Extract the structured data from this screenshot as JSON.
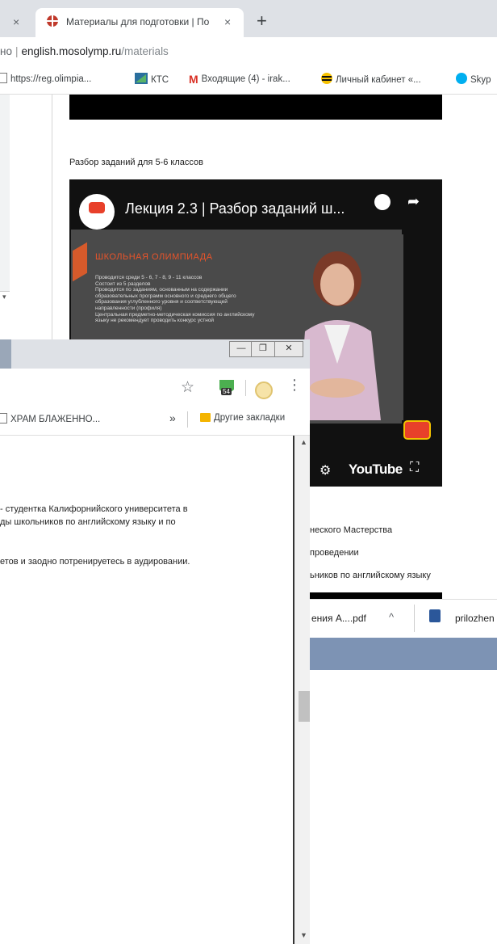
{
  "back_window": {
    "tab": {
      "title": "Материалы для подготовки | По",
      "close": "×"
    },
    "tab_left_close": "×",
    "new_tab": "+",
    "address": {
      "prefix": "но",
      "host": "english.mosolymp.ru",
      "path": "/materials"
    },
    "bookmarks": [
      {
        "label": "https://reg.olimpia..."
      },
      {
        "label": "КТС"
      },
      {
        "label": "Входящие (4) - irak..."
      },
      {
        "label": "Личный кабинет «..."
      },
      {
        "label": "Skyp"
      }
    ],
    "page": {
      "video_caption": "Разбор заданий для 5-6 классов",
      "video": {
        "title": "Лекция 2.3 | Разбор заданий ш...",
        "channel_logo": "Лекториум",
        "slide_heading": "ШКОЛЬНАЯ ОЛИМПИАДА",
        "slide_lines": [
          "Проводится среди 5 - 6, 7 - 8, 9 - 11 классов",
          "Состоит из 5 разделов",
          "Проводится по заданиям, основанным на содержании образовательных программ основного и среднего общего образования углубленного уровня и соответствующей направленности (профиля)",
          "Центральная предметно-методическая комиссия по английскому языку не рекомендует проводить конкурс устной"
        ],
        "youtube_label": "YouTube"
      },
      "right_lines": [
        "неского Мастерства",
        "проведении",
        "ьников по английскому языку"
      ]
    },
    "downloads": [
      {
        "name": "ения А....pdf",
        "chevron": "^"
      },
      {
        "name": "prilozhen"
      }
    ]
  },
  "front_window": {
    "window_controls": {
      "minimize": "—",
      "maximize": "❐",
      "close": "✕"
    },
    "extension_badge": "54",
    "bookmarks": {
      "item": "ХРАМ БЛАЖЕННО...",
      "more": "»",
      "other": "Другие закладки"
    },
    "text_lines": [
      "- студентка Калифорнийского университета в",
      "ды школьников по английскому языку и по",
      "етов и заодно потренируетесь в аудировании."
    ]
  },
  "colors": {
    "tab_strip": "#dee1e6",
    "accent_red": "#e8402a",
    "taskbar": "#7d93b4"
  }
}
